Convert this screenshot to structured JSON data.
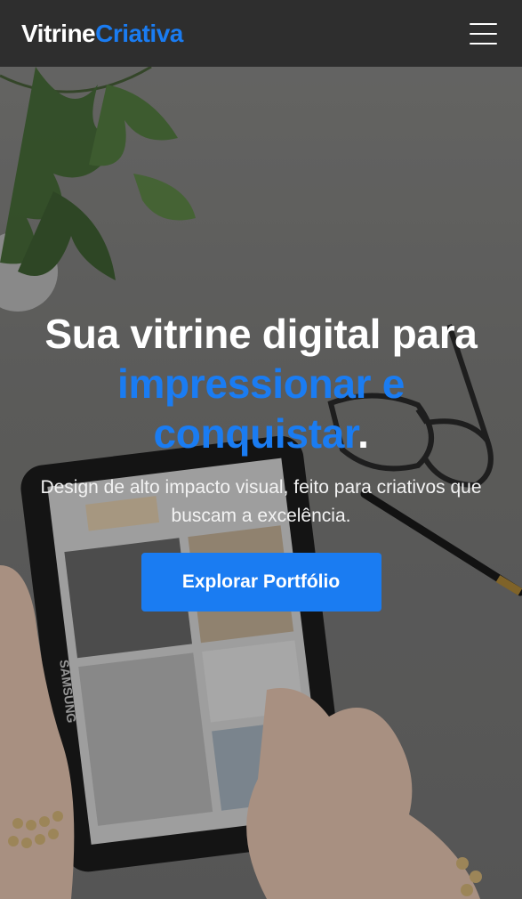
{
  "header": {
    "logo_main": "Vitrine",
    "logo_accent": "Criativa",
    "menu_icon": "hamburger-menu-icon"
  },
  "hero": {
    "title_line1": "Sua vitrine digital para",
    "title_highlight": "impressionar e conquistar",
    "title_end": ".",
    "subtitle": "Design de alto impacto visual, feito para criativos que buscam a excelência.",
    "cta_label": "Explorar Portfólio",
    "tablet_brand": "SAMSUNG"
  },
  "colors": {
    "accent": "#1a7cf2",
    "header_bg": "#2e2e2e",
    "text": "#ffffff"
  }
}
